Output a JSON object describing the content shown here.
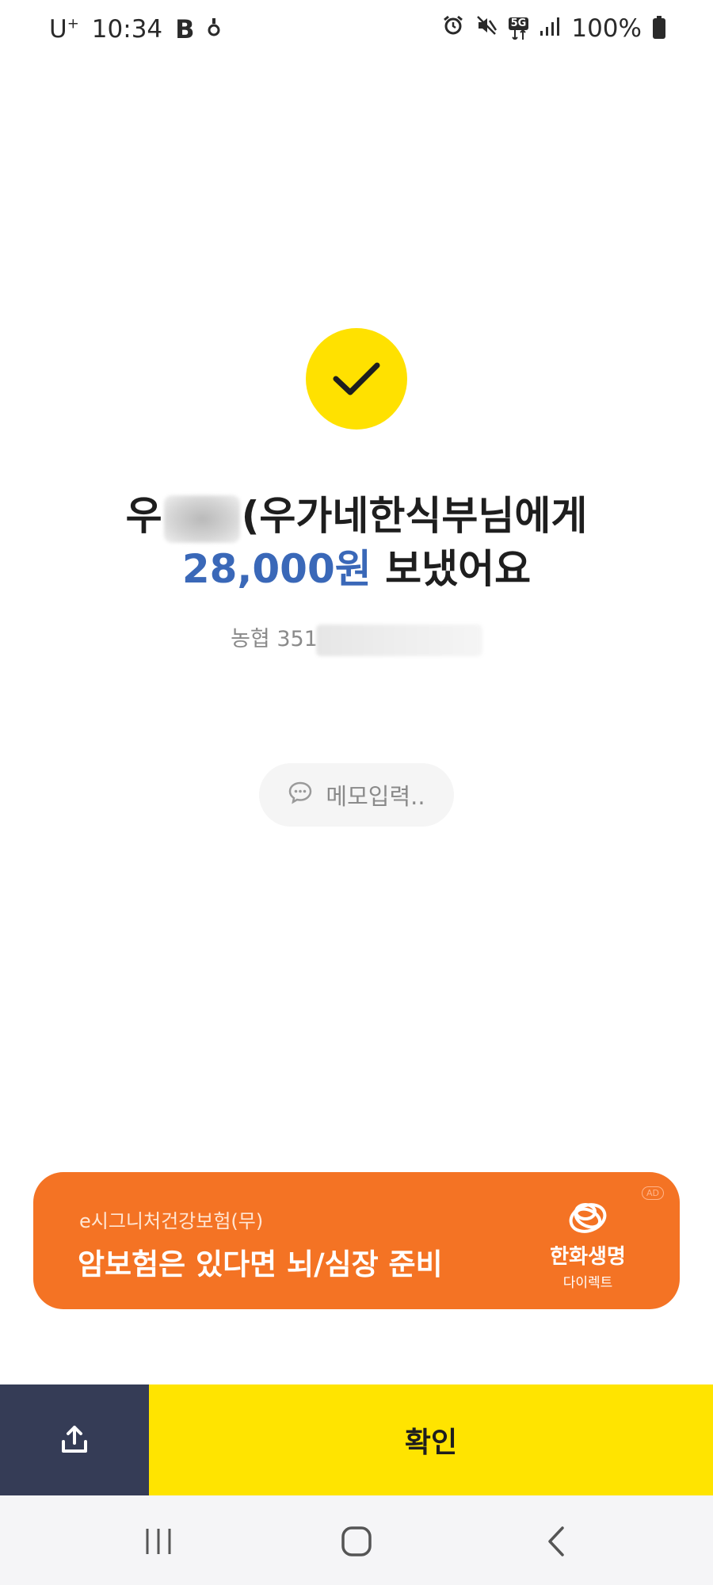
{
  "status_bar": {
    "carrier": "U",
    "carrier_sup": "+",
    "time": "10:34",
    "app_icon_letter": "B",
    "network": "5G",
    "battery": "100%"
  },
  "result": {
    "recipient_prefix": "우",
    "recipient_suffix": "(우가네한식부님에게",
    "amount": "28,000원",
    "sent_text": " 보냈어요",
    "bank_account": "농협 351"
  },
  "memo": {
    "label": "메모입력.."
  },
  "ad": {
    "subtitle": "e시그니처건강보험(무)",
    "headline": "암보험은 있다면 뇌/심장 준비",
    "badge": "AD",
    "brand": "한화생명",
    "brand_sub": "다이렉트"
  },
  "actions": {
    "confirm_label": "확인"
  },
  "icons": {
    "check": "check-icon",
    "share": "share-upload-icon",
    "memo": "speech-bubble-icon"
  },
  "colors": {
    "brand_yellow": "#ffe400",
    "amount_blue": "#3a68b8",
    "ad_orange": "#f47324",
    "share_navy": "#353c56"
  }
}
